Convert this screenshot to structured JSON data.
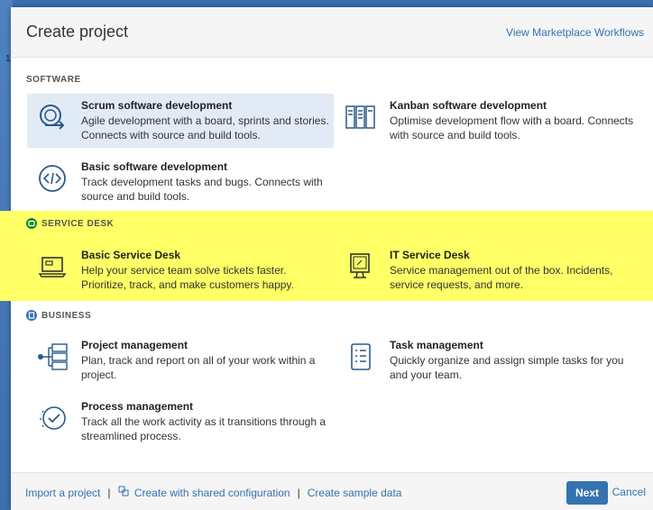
{
  "dialog": {
    "title": "Create project",
    "marketplace_link": "View Marketplace Workflows"
  },
  "backdrop": {
    "glyph": "1"
  },
  "sections": {
    "software": {
      "label": "SOFTWARE",
      "items": [
        {
          "title": "Scrum software development",
          "description": "Agile development with a board, sprints and stories. Connects with source and build tools.",
          "icon": "scrum-cycle-icon"
        },
        {
          "title": "Kanban software development",
          "description": "Optimise development flow with a board. Connects with source and build tools.",
          "icon": "kanban-columns-icon"
        },
        {
          "title": "Basic software development",
          "description": "Track development tasks and bugs. Connects with source and build tools.",
          "icon": "code-brackets-icon"
        }
      ]
    },
    "service_desk": {
      "label": "SERVICE DESK",
      "highlight_color": "#ffff66",
      "items": [
        {
          "title": "Basic Service Desk",
          "description": "Help your service team solve tickets faster. Prioritize, track, and make customers happy.",
          "icon": "laptop-icon"
        },
        {
          "title": "IT Service Desk",
          "description": "Service management out of the box. Incidents, service requests, and more.",
          "icon": "monitor-icon"
        }
      ]
    },
    "business": {
      "label": "BUSINESS",
      "items": [
        {
          "title": "Project management",
          "description": "Plan, track and report on all of your work within a project.",
          "icon": "project-tree-icon"
        },
        {
          "title": "Task management",
          "description": "Quickly organize and assign simple tasks for you and your team.",
          "icon": "task-list-icon"
        },
        {
          "title": "Process management",
          "description": "Track all the work activity as it transitions through a streamlined process.",
          "icon": "process-check-icon"
        }
      ]
    }
  },
  "footer": {
    "import_link": "Import a project",
    "separator": "|",
    "shared_config_link": "Create with shared configuration",
    "sample_data_link": "Create sample data",
    "next_button": "Next",
    "cancel_link": "Cancel"
  },
  "colors": {
    "accent": "#3572b0",
    "selected_card": "#e2ebf5",
    "service_desk_badge": "#14892c",
    "business_badge": "#3572b0"
  }
}
